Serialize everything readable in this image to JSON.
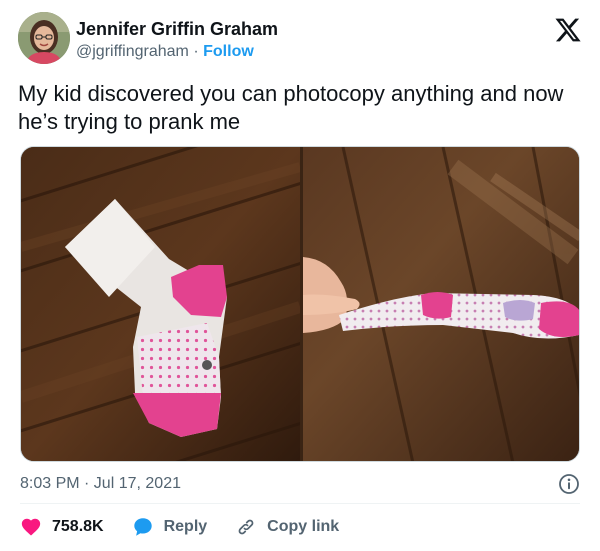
{
  "author": {
    "display_name": "Jennifer Griffin Graham",
    "handle": "@jgriffingraham",
    "separator": "·",
    "follow_label": "Follow"
  },
  "tweet": {
    "text": "My kid discovered you can photocopy anything and now he’s trying to prank me",
    "timestamp": "8:03 PM · Jul 17, 2021"
  },
  "actions": {
    "like_count": "758.8K",
    "reply_label": "Reply",
    "copy_link_label": "Copy link"
  },
  "icons": {
    "platform_logo": "x-logo",
    "info": "info-icon",
    "like": "heart-icon",
    "reply": "speech-bubble-icon",
    "copy_link": "link-icon"
  },
  "colors": {
    "accent": "#1d9bf0",
    "like": "#f91880",
    "text": "#0f1419",
    "secondary_text": "#536471"
  }
}
